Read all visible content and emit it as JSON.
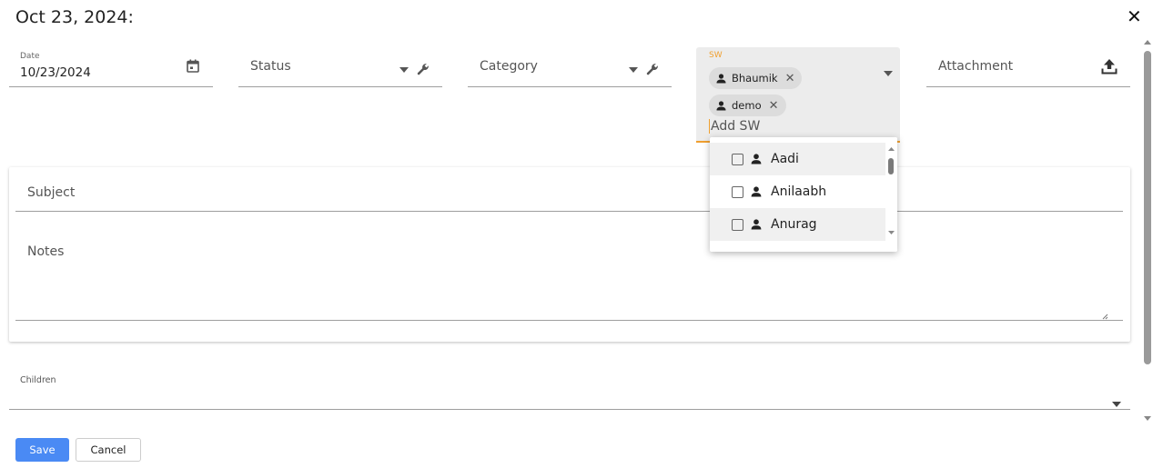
{
  "dialog": {
    "title": "Oct 23, 2024:",
    "close_glyph": "✕"
  },
  "fields": {
    "date": {
      "label": "Date",
      "value": "10/23/2024",
      "icon": "calendar-icon"
    },
    "status": {
      "placeholder": "Status",
      "icons": [
        "dropdown-arrow-icon",
        "wrench-icon"
      ]
    },
    "category": {
      "placeholder": "Category",
      "icons": [
        "dropdown-arrow-icon",
        "wrench-icon"
      ]
    },
    "sw": {
      "label": "SW",
      "chips": [
        {
          "label": "Bhaumik",
          "icon": "person-icon"
        },
        {
          "label": "demo",
          "icon": "person-icon"
        }
      ],
      "input_placeholder": "Add SW",
      "remove_glyph": "✕"
    },
    "attachment": {
      "placeholder": "Attachment",
      "icon": "upload-icon"
    }
  },
  "sw_dropdown": {
    "options": [
      {
        "label": "Aadi",
        "checked": false
      },
      {
        "label": "Anilaabh",
        "checked": false
      },
      {
        "label": "Anurag",
        "checked": false
      }
    ]
  },
  "card": {
    "subject_placeholder": "Subject",
    "notes_placeholder": "Notes"
  },
  "children": {
    "label": "Children"
  },
  "buttons": {
    "save": "Save",
    "cancel": "Cancel"
  },
  "colors": {
    "accent": "#f0a030",
    "primary_button": "#4a8af4",
    "field_bg": "#ececec"
  }
}
